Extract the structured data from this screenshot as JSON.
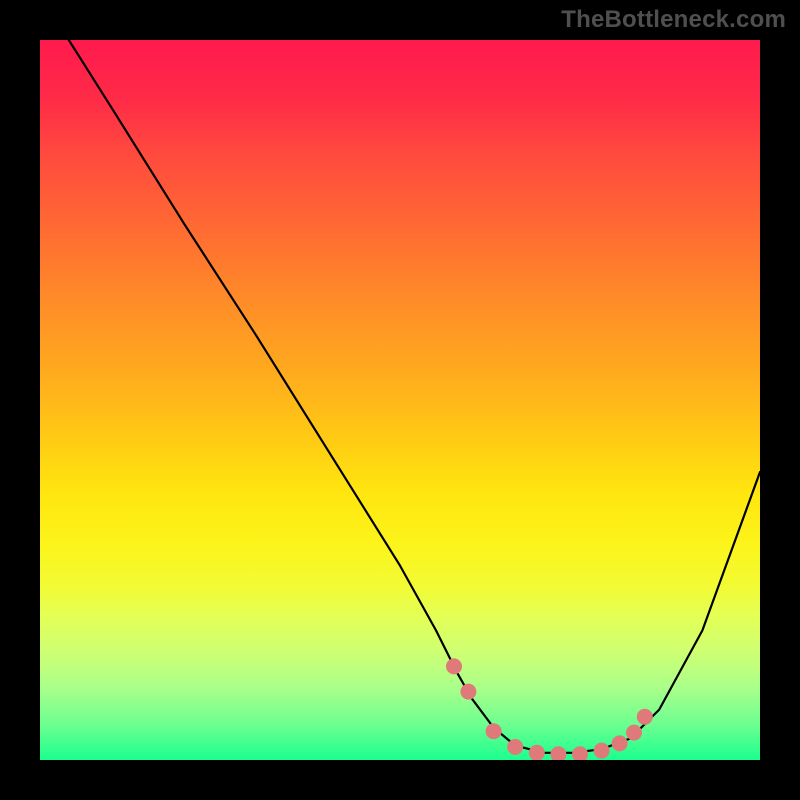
{
  "watermark": "TheBottleneck.com",
  "chart_data": {
    "type": "line",
    "title": "",
    "xlabel": "",
    "ylabel": "",
    "xlim": [
      0,
      100
    ],
    "ylim": [
      0,
      100
    ],
    "series": [
      {
        "name": "curve",
        "x": [
          4,
          10,
          20,
          30,
          40,
          50,
          55,
          58,
          60,
          63,
          66,
          70,
          74,
          78,
          82,
          86,
          92,
          100
        ],
        "y": [
          100,
          90.5,
          74.5,
          59,
          43,
          27,
          18,
          12,
          8.5,
          4.5,
          2,
          1,
          1,
          1.5,
          3,
          7,
          18,
          40
        ]
      }
    ],
    "markers": {
      "name": "highlight-dots",
      "color": "#e07a7a",
      "x": [
        57.5,
        59.5,
        63,
        66,
        69,
        72,
        75,
        78,
        80.5,
        82.5,
        84
      ],
      "y": [
        13,
        9.5,
        4,
        1.8,
        1,
        0.8,
        0.8,
        1.3,
        2.3,
        3.8,
        6
      ]
    }
  },
  "colors": {
    "frame": "#000000",
    "curve": "#000000",
    "marker": "#e07a7a",
    "watermark": "#4f4f4f"
  }
}
